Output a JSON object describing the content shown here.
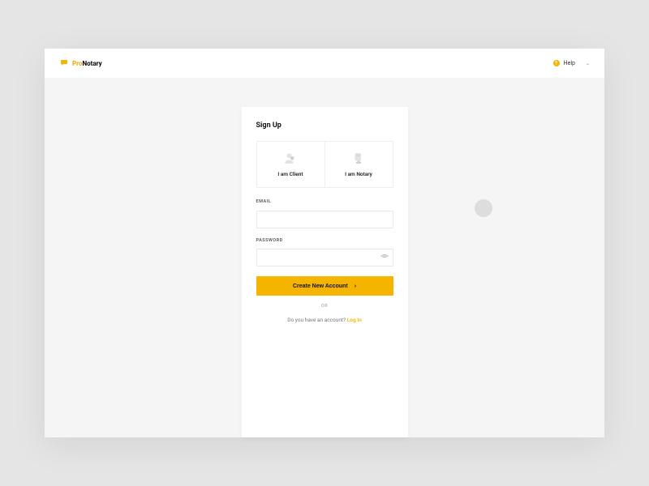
{
  "brand": {
    "prefix": "Pro",
    "suffix": "Notary"
  },
  "header": {
    "help_label": "Help"
  },
  "signup": {
    "title": "Sign Up",
    "roles": [
      {
        "label": "I am Client"
      },
      {
        "label": "I am Notary"
      }
    ],
    "email_label": "EMAIL",
    "password_label": "PASSWORD",
    "submit_label": "Create New Account",
    "or_label": "OR",
    "footer_prompt": "Do you have an account? ",
    "footer_link": "Log In"
  },
  "colors": {
    "accent": "#f5b400"
  }
}
